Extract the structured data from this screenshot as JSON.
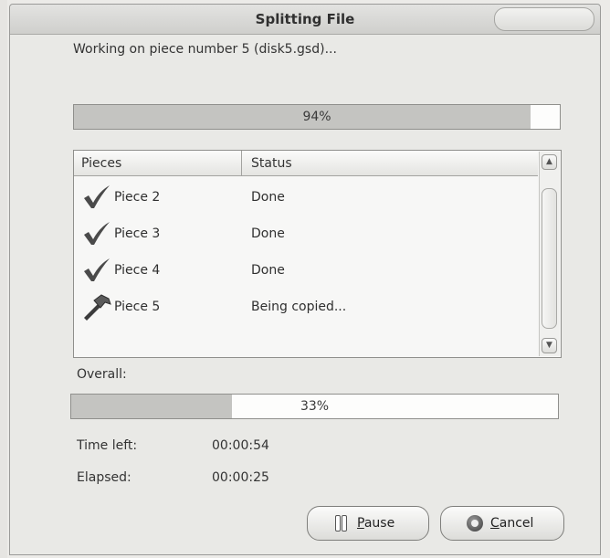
{
  "window": {
    "title": "Splitting File"
  },
  "status_message": "Working on piece number 5 (disk5.gsd)...",
  "piece_progress": {
    "percent_label": "94%",
    "value": 94
  },
  "list": {
    "columns": [
      "Pieces",
      "Status"
    ],
    "rows": [
      {
        "name": "Piece 2",
        "status": "Done",
        "icon": "checkmark-icon"
      },
      {
        "name": "Piece 3",
        "status": "Done",
        "icon": "checkmark-icon"
      },
      {
        "name": "Piece 4",
        "status": "Done",
        "icon": "checkmark-icon"
      },
      {
        "name": "Piece 5",
        "status": "Being copied...",
        "icon": "hammer-icon"
      }
    ]
  },
  "overall": {
    "label": "Overall:",
    "percent_label": "33%",
    "value": 33
  },
  "time_left": {
    "label": "Time left:",
    "value": "00:00:54"
  },
  "elapsed": {
    "label": "Elapsed:",
    "value": "00:00:25"
  },
  "buttons": {
    "pause_label": "Pause",
    "cancel_label": "Cancel"
  },
  "colors": {
    "progress_fill": "#c4c4c1",
    "window_background": "#e9e9e6"
  }
}
